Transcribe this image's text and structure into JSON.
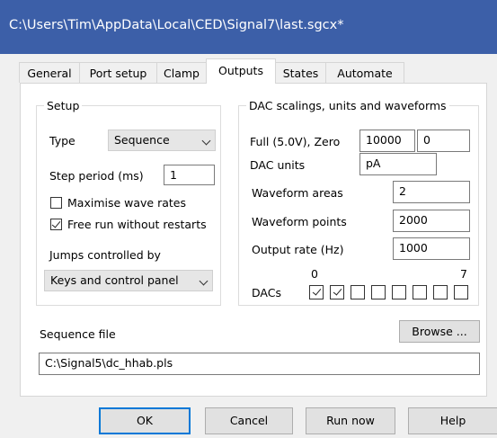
{
  "window": {
    "title": "C:\\Users\\Tim\\AppData\\Local\\CED\\Signal7\\last.sgcx*"
  },
  "tabs": [
    {
      "label": "General",
      "active": false
    },
    {
      "label": "Port setup",
      "active": false
    },
    {
      "label": "Clamp",
      "active": false
    },
    {
      "label": "Outputs",
      "active": true
    },
    {
      "label": "States",
      "active": false
    },
    {
      "label": "Automate",
      "active": false
    }
  ],
  "setup": {
    "title": "Setup",
    "type_label": "Type",
    "type_value": "Sequence",
    "step_period_label": "Step period (ms)",
    "step_period_value": "1",
    "maximise_label": "Maximise wave rates",
    "maximise_checked": false,
    "free_run_label": "Free run without restarts",
    "free_run_checked": true,
    "jumps_label": "Jumps controlled by",
    "jumps_value": "Keys and control panel"
  },
  "dac": {
    "title": "DAC scalings, units and waveforms",
    "full_zero_label": "Full (5.0V), Zero",
    "full_value": "10000",
    "zero_value": "0",
    "units_label": "DAC units",
    "units_value": "pA",
    "areas_label": "Waveform areas",
    "areas_value": "2",
    "points_label": "Waveform points",
    "points_value": "2000",
    "rate_label": "Output rate (Hz)",
    "rate_value": "1000",
    "dacs_label": "DACs",
    "dacs_first": "0",
    "dacs_last": "7",
    "dacs": [
      true,
      true,
      false,
      false,
      false,
      false,
      false,
      false
    ]
  },
  "sequence": {
    "label": "Sequence file",
    "browse_label": "Browse ...",
    "path": "C:\\Signal5\\dc_hhab.pls"
  },
  "buttons": {
    "ok": "OK",
    "cancel": "Cancel",
    "run_now": "Run now",
    "help": "Help"
  },
  "colors": {
    "titlebar": "#3c5fa8",
    "dialog_bg": "#f0f0f0",
    "default_button_border": "#0078d7"
  }
}
